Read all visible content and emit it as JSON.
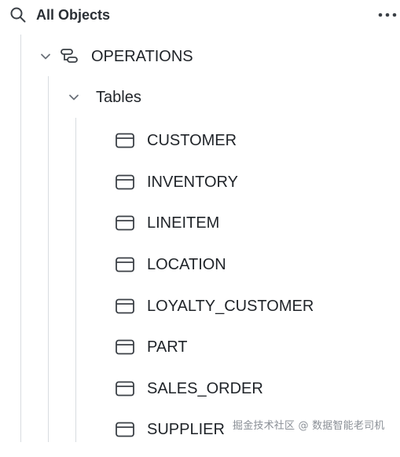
{
  "header": {
    "title": "All Objects"
  },
  "tree": {
    "schema": {
      "label": "OPERATIONS",
      "expanded": true
    },
    "folder": {
      "label": "Tables",
      "expanded": true
    },
    "tables": [
      "CUSTOMER",
      "INVENTORY",
      "LINEITEM",
      "LOCATION",
      "LOYALTY_CUSTOMER",
      "PART",
      "SALES_ORDER",
      "SUPPLIER"
    ]
  },
  "watermark": {
    "text": "掘金技术社区 @ 数据智能老司机"
  },
  "colors": {
    "text": "#1f2328",
    "icon": "#3b4046",
    "guide": "#d8dce0",
    "watermark": "#8a8f96"
  },
  "icons": {
    "search": "search-icon",
    "more": "more-options-icon",
    "chevron": "chevron-down-icon",
    "schema": "schema-icon",
    "table": "table-icon"
  }
}
